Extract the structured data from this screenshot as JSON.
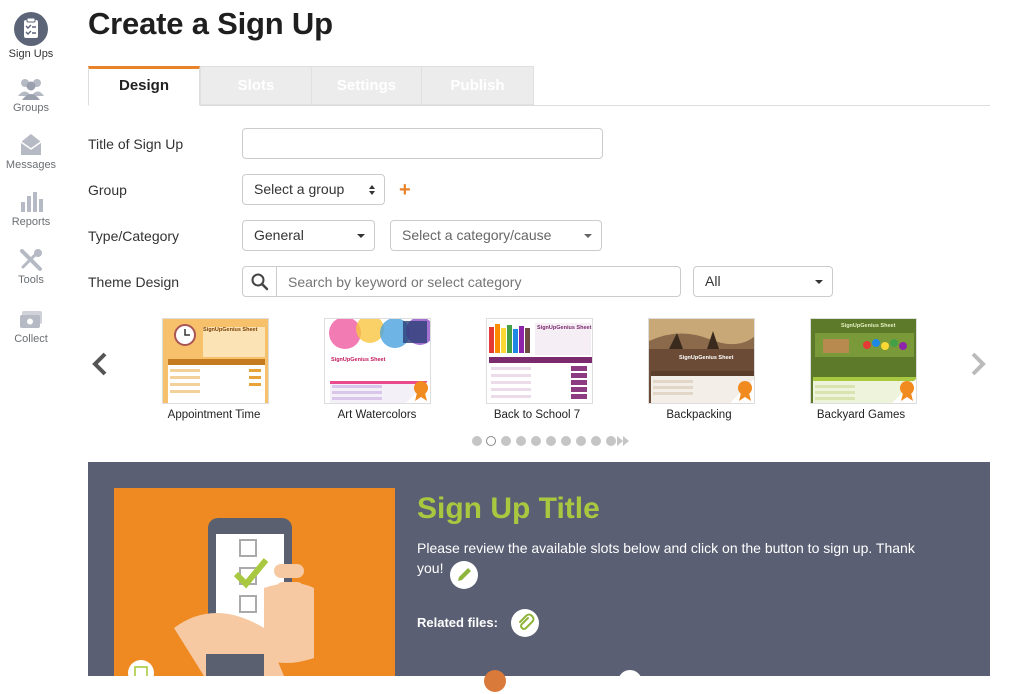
{
  "sidebar": {
    "items": [
      {
        "label": "Sign Ups",
        "icon": "clipboard-icon"
      },
      {
        "label": "Groups",
        "icon": "people-icon"
      },
      {
        "label": "Messages",
        "icon": "envelope-icon"
      },
      {
        "label": "Reports",
        "icon": "bar-chart-icon"
      },
      {
        "label": "Tools",
        "icon": "tools-icon"
      },
      {
        "label": "Collect",
        "icon": "money-icon"
      }
    ]
  },
  "page": {
    "title": "Create a Sign Up"
  },
  "tabs": [
    {
      "label": "Design",
      "active": true
    },
    {
      "label": "Slots",
      "active": false
    },
    {
      "label": "Settings",
      "active": false
    },
    {
      "label": "Publish",
      "active": false
    }
  ],
  "form": {
    "title_label": "Title of Sign Up",
    "title_value": "",
    "group_label": "Group",
    "group_value": "Select a group",
    "type_label": "Type/Category",
    "type_value": "General",
    "category_value": "Select a category/cause",
    "theme_label": "Theme Design",
    "search_placeholder": "Search by keyword or select category",
    "theme_filter": "All"
  },
  "themes": [
    {
      "label": "Appointment Time",
      "sheet_title": "SignUpGenius Sheet",
      "color": "#f2b24a",
      "premium": false
    },
    {
      "label": "Art Watercolors",
      "sheet_title": "SignUpGenius Sheet",
      "color": "#e96aa6",
      "premium": true
    },
    {
      "label": "Back to School 7",
      "sheet_title": "SignUpGenius Sheet",
      "color": "#8a2d7a",
      "premium": false
    },
    {
      "label": "Backpacking",
      "sheet_title": "SignUpGenius Sheet",
      "color": "#6a4a35",
      "premium": true
    },
    {
      "label": "Backyard Games",
      "sheet_title": "SignUpGenius Sheet",
      "color": "#5c7a2a",
      "premium": true
    }
  ],
  "carousel": {
    "pages": 10,
    "active_page": 2
  },
  "preview": {
    "title": "Sign Up Title",
    "description": "Please review the available slots below and click on the button to sign up. Thank you!",
    "related_files": "Related files:"
  },
  "colors": {
    "accent": "#e8832a",
    "preview_bg": "#5a5f73",
    "preview_title": "#a8c93f"
  }
}
